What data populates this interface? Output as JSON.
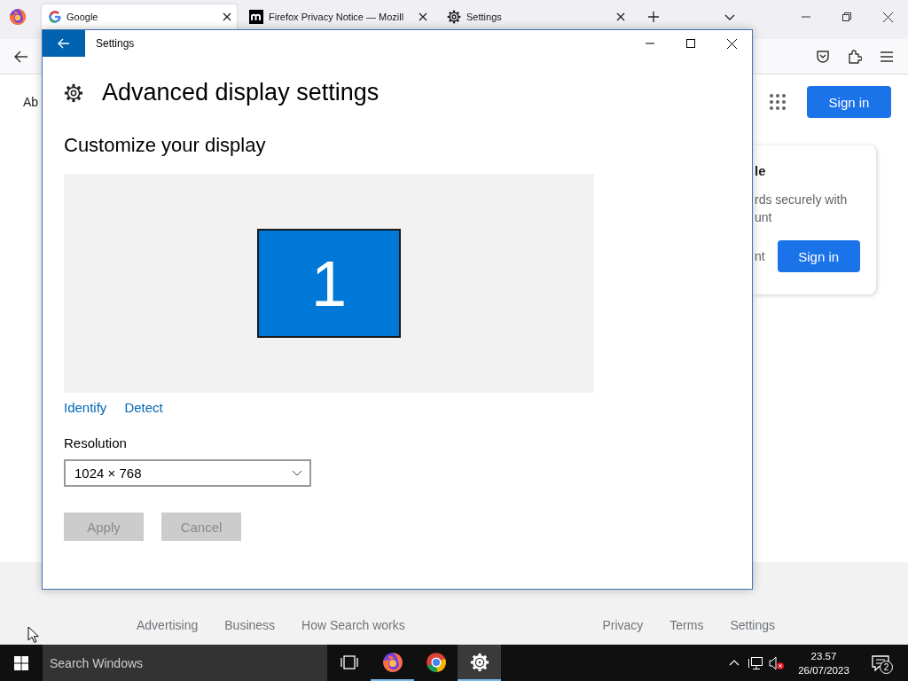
{
  "browser": {
    "tabs": [
      {
        "kind": "google",
        "title": "Google",
        "selected": true
      },
      {
        "kind": "mozilla",
        "title": "Firefox Privacy Notice — Mozill",
        "selected": false
      },
      {
        "kind": "settings",
        "title": "Settings",
        "selected": false
      }
    ],
    "page": {
      "left_text": "Ab",
      "sign_in": "Sign in",
      "card": {
        "title": "le",
        "body": [
          "rds securely with",
          "unt"
        ],
        "secondary": "nt",
        "button": "Sign in"
      },
      "footer_left": [
        "Advertising",
        "Business",
        "How Search works"
      ],
      "footer_right": [
        "Privacy",
        "Terms",
        "Settings"
      ]
    }
  },
  "settings_window": {
    "title": "Settings",
    "heading": "Advanced display settings",
    "subheading": "Customize your display",
    "monitor": "1",
    "links": [
      "Identify",
      "Detect"
    ],
    "resolution": {
      "label": "Resolution",
      "value": "1024 × 768"
    },
    "buttons": [
      {
        "label": "Apply",
        "disabled": true
      },
      {
        "label": "Cancel",
        "disabled": true
      }
    ]
  },
  "taskbar": {
    "search_placeholder": "Search Windows",
    "apps": [
      {
        "kind": "task-view",
        "open": false,
        "selected": false
      },
      {
        "kind": "firefox",
        "open": true,
        "selected": false
      },
      {
        "kind": "chrome",
        "open": false,
        "selected": false
      },
      {
        "kind": "settings",
        "open": true,
        "selected": true
      }
    ],
    "time": "23.57",
    "date": "26/07/2023",
    "notifications": "2"
  }
}
